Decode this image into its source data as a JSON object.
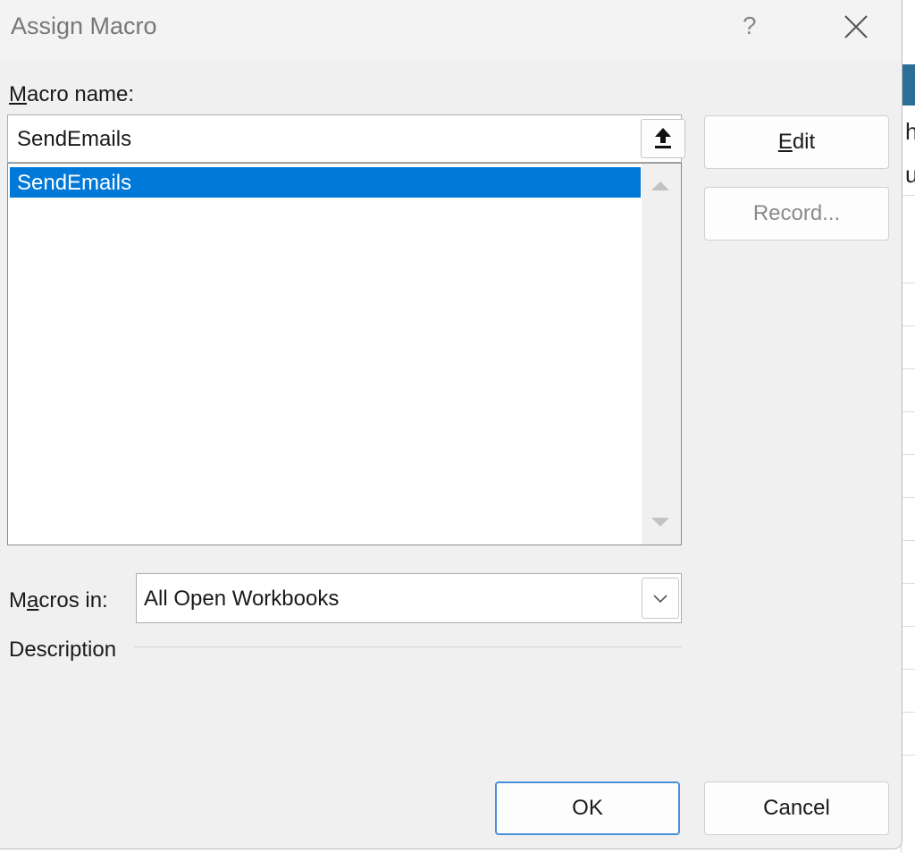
{
  "dialog": {
    "title": "Assign Macro",
    "help_label": "?",
    "close_icon": "close-icon"
  },
  "macro_name": {
    "label_accel": "M",
    "label_rest": "acro name:",
    "value": "SendEmails",
    "upload_icon": "arrow-up-icon"
  },
  "macro_list": {
    "items": [
      "SendEmails"
    ],
    "selected_index": 0,
    "selection_color": "#0078d7"
  },
  "buttons": {
    "edit_accel": "E",
    "edit_rest": "dit",
    "record": "Record...",
    "ok": "OK",
    "cancel": "Cancel"
  },
  "macros_in": {
    "label_pre": "M",
    "label_accel": "a",
    "label_rest": "cros in:",
    "value": "All Open Workbooks"
  },
  "description": {
    "label": "Description"
  }
}
